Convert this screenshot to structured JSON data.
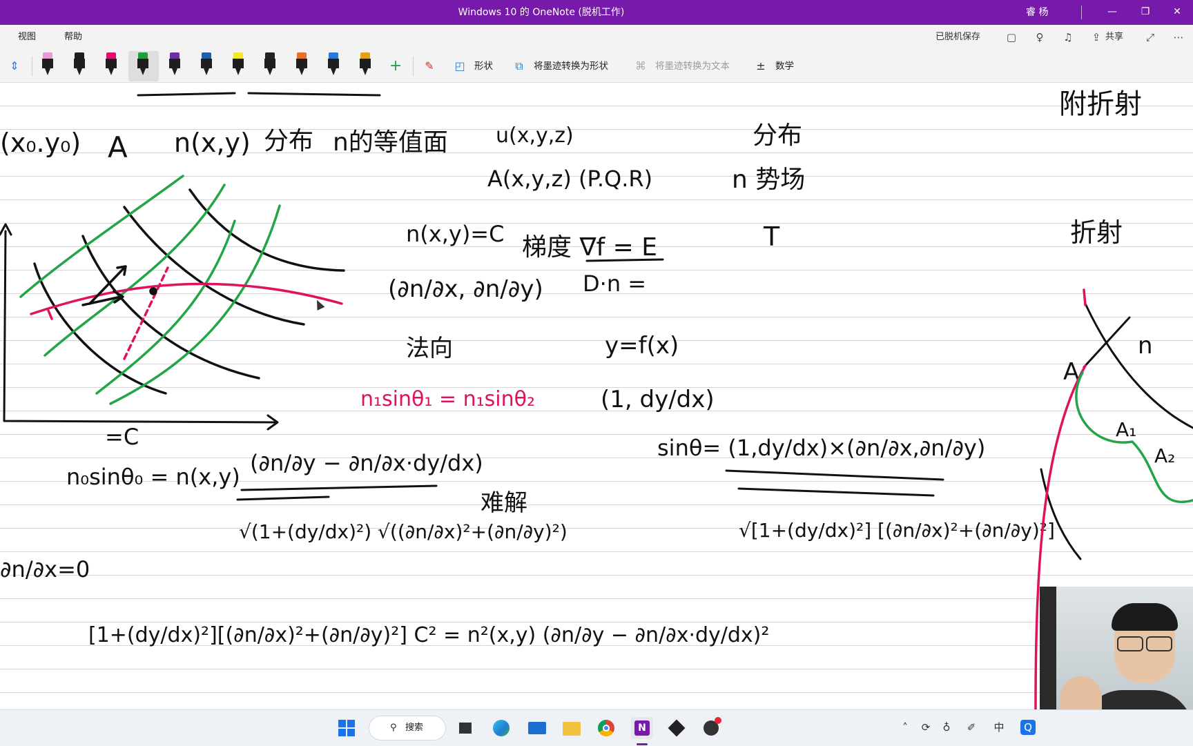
{
  "window": {
    "title": "Windows 10 的 OneNote (脱机工作)",
    "user": "睿 杨",
    "minimize_glyph": "—",
    "restore_glyph": "❐",
    "close_glyph": "✕"
  },
  "menu": {
    "view": "视图",
    "help": "帮助",
    "offline_saved": "已脱机保存",
    "share": "共享"
  },
  "toolbar": {
    "pens": [
      {
        "color": "#e89ad6",
        "name": "pen-pink-light"
      },
      {
        "color": "#1e1e1e",
        "name": "pen-black"
      },
      {
        "color": "#e0116b",
        "name": "pen-magenta"
      },
      {
        "color": "#1f9d3f",
        "name": "pen-green"
      },
      {
        "color": "#6b2fa3",
        "name": "pen-purple"
      },
      {
        "color": "#1f5fa8",
        "name": "pen-blue"
      },
      {
        "color": "#f5e62a",
        "name": "highlighter-yellow"
      },
      {
        "color": "#222222",
        "name": "pen-galaxy"
      },
      {
        "color": "#e8702a",
        "name": "pen-rainbow"
      },
      {
        "color": "#2a7ad6",
        "name": "pen-ocean"
      },
      {
        "color": "#e0a21a",
        "name": "pen-gold"
      }
    ],
    "shapes_label": "形状",
    "ink_to_shape_label": "将墨迹转换为形状",
    "ink_to_text_label": "将墨迹转换为文本",
    "math_label": "数学",
    "add_glyph": "+"
  },
  "taskbar": {
    "search_label": "搜索",
    "ime_label": "中"
  },
  "colors": {
    "accent": "#7719aa",
    "ink_black": "#111111",
    "ink_green": "#22a447",
    "ink_pink": "#e0115f"
  }
}
